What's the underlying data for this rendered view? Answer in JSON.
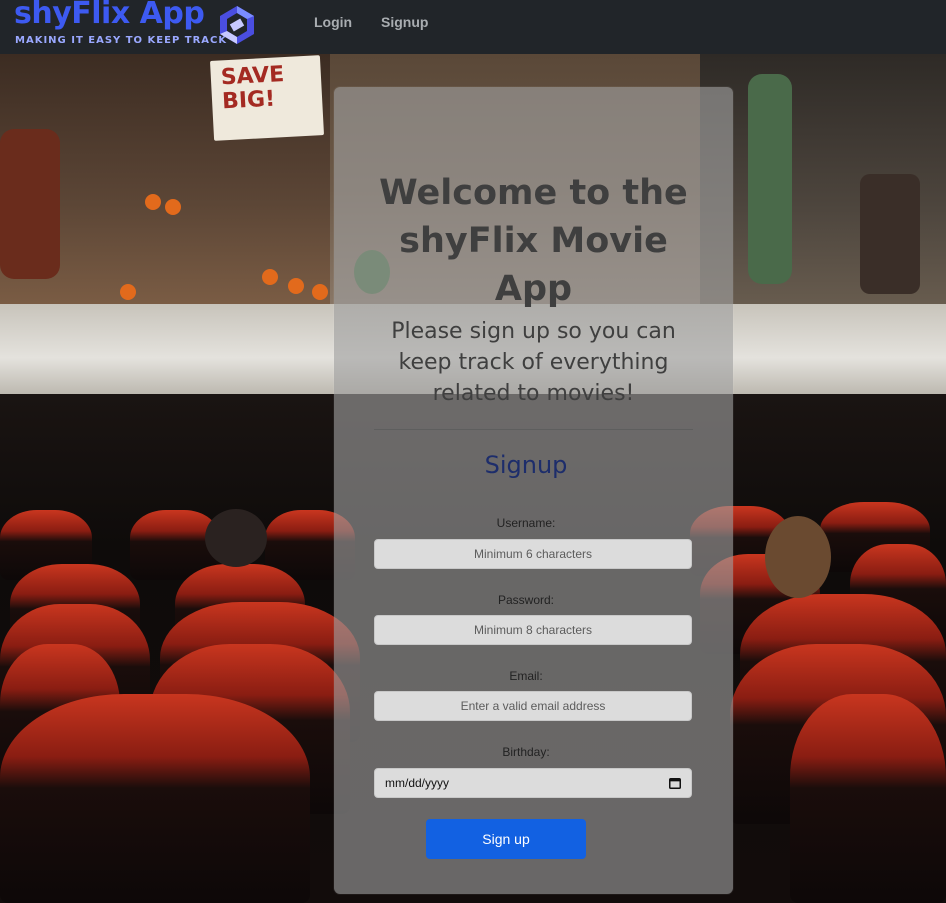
{
  "navbar": {
    "brand_name": "shyFlix App",
    "brand_tagline": "MAKING IT EASY TO KEEP TRACK",
    "links": [
      {
        "label": "Login"
      },
      {
        "label": "Signup"
      }
    ]
  },
  "background": {
    "sign_text": "SAVE BIG!"
  },
  "card": {
    "title": "Welcome to the shyFlix Movie App",
    "subtitle": "Please sign up so you can keep track of everything related to movies!",
    "form_heading": "Signup",
    "fields": {
      "username": {
        "label": "Username:",
        "placeholder": "Minimum 6 characters",
        "value": ""
      },
      "password": {
        "label": "Password:",
        "placeholder": "Minimum 8 characters",
        "value": ""
      },
      "email": {
        "label": "Email:",
        "placeholder": "Enter a valid email address",
        "value": ""
      },
      "birthday": {
        "label": "Birthday:",
        "display_value": "mm/dd/yyyy"
      }
    },
    "submit_label": "Sign up"
  },
  "colors": {
    "navbar_bg": "#212529",
    "brand": "#3d5af1",
    "primary_button": "#1261e2",
    "form_heading": "#1d2d6b"
  },
  "icons": [
    "logo-cube-icon",
    "calendar-icon"
  ]
}
